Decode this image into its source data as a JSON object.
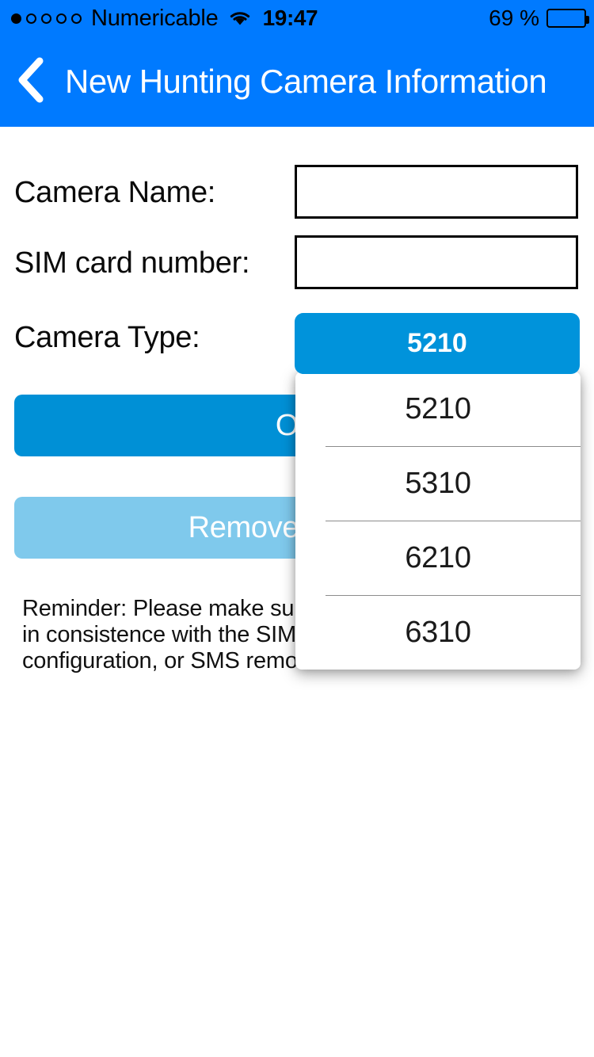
{
  "status_bar": {
    "signal_dots_total": 5,
    "signal_dots_filled": 1,
    "carrier": "Numericable",
    "wifi_icon": "wifi-icon",
    "time": "19:47",
    "battery_percent": "69 %",
    "battery_level": 69
  },
  "nav": {
    "back_icon": "chevron-left-icon",
    "title": "New Hunting Camera Information"
  },
  "form": {
    "camera_name": {
      "label": "Camera Name:",
      "value": "",
      "placeholder": ""
    },
    "sim_number": {
      "label": "SIM card number:",
      "value": "",
      "placeholder": ""
    },
    "camera_type": {
      "label": "Camera Type:",
      "selected": "5210",
      "options": [
        "5210",
        "5310",
        "6210",
        "6310"
      ]
    }
  },
  "buttons": {
    "ok_label": "OK",
    "remove_label": "Remove camera"
  },
  "reminder": {
    "text": "Reminder: Please make sure the SIM card number is in consistence with the SIM card number in camera configuration, or SMS remote control will not work."
  },
  "colors": {
    "nav_blue": "#007AFF",
    "dropdown_blue": "#0093DB",
    "ok_blue": "#0090D6",
    "remove_blue": "#7FC9EC",
    "text_black": "#111111"
  }
}
